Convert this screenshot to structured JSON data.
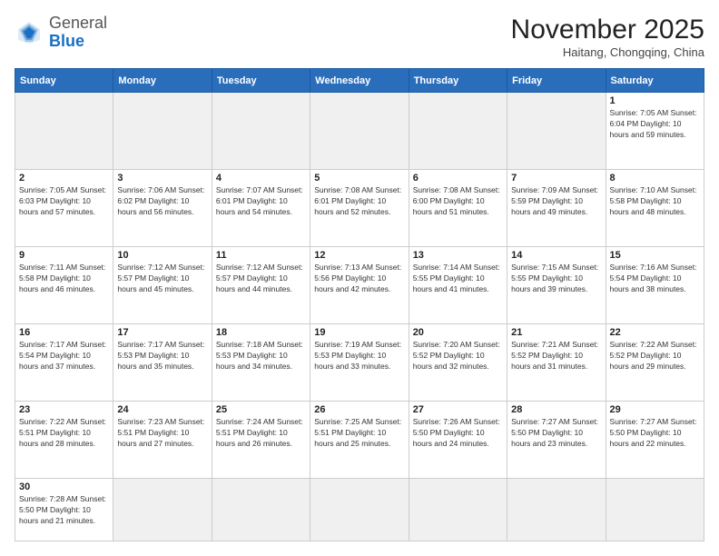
{
  "header": {
    "logo_general": "General",
    "logo_blue": "Blue",
    "month_title": "November 2025",
    "location": "Haitang, Chongqing, China"
  },
  "days_of_week": [
    "Sunday",
    "Monday",
    "Tuesday",
    "Wednesday",
    "Thursday",
    "Friday",
    "Saturday"
  ],
  "weeks": [
    [
      {
        "day": "",
        "info": "",
        "empty": true
      },
      {
        "day": "",
        "info": "",
        "empty": true
      },
      {
        "day": "",
        "info": "",
        "empty": true
      },
      {
        "day": "",
        "info": "",
        "empty": true
      },
      {
        "day": "",
        "info": "",
        "empty": true
      },
      {
        "day": "",
        "info": "",
        "empty": true
      },
      {
        "day": "1",
        "info": "Sunrise: 7:05 AM\nSunset: 6:04 PM\nDaylight: 10 hours and 59 minutes."
      }
    ],
    [
      {
        "day": "2",
        "info": "Sunrise: 7:05 AM\nSunset: 6:03 PM\nDaylight: 10 hours and 57 minutes."
      },
      {
        "day": "3",
        "info": "Sunrise: 7:06 AM\nSunset: 6:02 PM\nDaylight: 10 hours and 56 minutes."
      },
      {
        "day": "4",
        "info": "Sunrise: 7:07 AM\nSunset: 6:01 PM\nDaylight: 10 hours and 54 minutes."
      },
      {
        "day": "5",
        "info": "Sunrise: 7:08 AM\nSunset: 6:01 PM\nDaylight: 10 hours and 52 minutes."
      },
      {
        "day": "6",
        "info": "Sunrise: 7:08 AM\nSunset: 6:00 PM\nDaylight: 10 hours and 51 minutes."
      },
      {
        "day": "7",
        "info": "Sunrise: 7:09 AM\nSunset: 5:59 PM\nDaylight: 10 hours and 49 minutes."
      },
      {
        "day": "8",
        "info": "Sunrise: 7:10 AM\nSunset: 5:58 PM\nDaylight: 10 hours and 48 minutes."
      }
    ],
    [
      {
        "day": "9",
        "info": "Sunrise: 7:11 AM\nSunset: 5:58 PM\nDaylight: 10 hours and 46 minutes."
      },
      {
        "day": "10",
        "info": "Sunrise: 7:12 AM\nSunset: 5:57 PM\nDaylight: 10 hours and 45 minutes."
      },
      {
        "day": "11",
        "info": "Sunrise: 7:12 AM\nSunset: 5:57 PM\nDaylight: 10 hours and 44 minutes."
      },
      {
        "day": "12",
        "info": "Sunrise: 7:13 AM\nSunset: 5:56 PM\nDaylight: 10 hours and 42 minutes."
      },
      {
        "day": "13",
        "info": "Sunrise: 7:14 AM\nSunset: 5:55 PM\nDaylight: 10 hours and 41 minutes."
      },
      {
        "day": "14",
        "info": "Sunrise: 7:15 AM\nSunset: 5:55 PM\nDaylight: 10 hours and 39 minutes."
      },
      {
        "day": "15",
        "info": "Sunrise: 7:16 AM\nSunset: 5:54 PM\nDaylight: 10 hours and 38 minutes."
      }
    ],
    [
      {
        "day": "16",
        "info": "Sunrise: 7:17 AM\nSunset: 5:54 PM\nDaylight: 10 hours and 37 minutes."
      },
      {
        "day": "17",
        "info": "Sunrise: 7:17 AM\nSunset: 5:53 PM\nDaylight: 10 hours and 35 minutes."
      },
      {
        "day": "18",
        "info": "Sunrise: 7:18 AM\nSunset: 5:53 PM\nDaylight: 10 hours and 34 minutes."
      },
      {
        "day": "19",
        "info": "Sunrise: 7:19 AM\nSunset: 5:53 PM\nDaylight: 10 hours and 33 minutes."
      },
      {
        "day": "20",
        "info": "Sunrise: 7:20 AM\nSunset: 5:52 PM\nDaylight: 10 hours and 32 minutes."
      },
      {
        "day": "21",
        "info": "Sunrise: 7:21 AM\nSunset: 5:52 PM\nDaylight: 10 hours and 31 minutes."
      },
      {
        "day": "22",
        "info": "Sunrise: 7:22 AM\nSunset: 5:52 PM\nDaylight: 10 hours and 29 minutes."
      }
    ],
    [
      {
        "day": "23",
        "info": "Sunrise: 7:22 AM\nSunset: 5:51 PM\nDaylight: 10 hours and 28 minutes."
      },
      {
        "day": "24",
        "info": "Sunrise: 7:23 AM\nSunset: 5:51 PM\nDaylight: 10 hours and 27 minutes."
      },
      {
        "day": "25",
        "info": "Sunrise: 7:24 AM\nSunset: 5:51 PM\nDaylight: 10 hours and 26 minutes."
      },
      {
        "day": "26",
        "info": "Sunrise: 7:25 AM\nSunset: 5:51 PM\nDaylight: 10 hours and 25 minutes."
      },
      {
        "day": "27",
        "info": "Sunrise: 7:26 AM\nSunset: 5:50 PM\nDaylight: 10 hours and 24 minutes."
      },
      {
        "day": "28",
        "info": "Sunrise: 7:27 AM\nSunset: 5:50 PM\nDaylight: 10 hours and 23 minutes."
      },
      {
        "day": "29",
        "info": "Sunrise: 7:27 AM\nSunset: 5:50 PM\nDaylight: 10 hours and 22 minutes."
      }
    ],
    [
      {
        "day": "30",
        "info": "Sunrise: 7:28 AM\nSunset: 5:50 PM\nDaylight: 10 hours and 21 minutes.",
        "last": true
      },
      {
        "day": "",
        "info": "",
        "empty": true,
        "last": true
      },
      {
        "day": "",
        "info": "",
        "empty": true,
        "last": true
      },
      {
        "day": "",
        "info": "",
        "empty": true,
        "last": true
      },
      {
        "day": "",
        "info": "",
        "empty": true,
        "last": true
      },
      {
        "day": "",
        "info": "",
        "empty": true,
        "last": true
      },
      {
        "day": "",
        "info": "",
        "empty": true,
        "last": true
      }
    ]
  ]
}
